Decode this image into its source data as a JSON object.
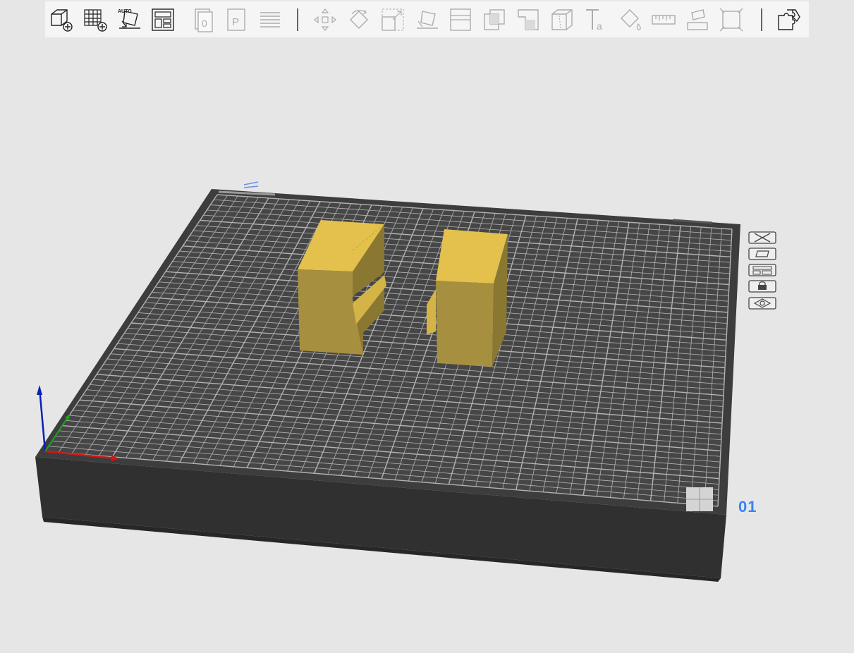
{
  "toolbar": {
    "buttons": [
      {
        "id": "add-object",
        "enabled": true
      },
      {
        "id": "add-plate",
        "enabled": true
      },
      {
        "id": "auto-orient",
        "label": "AUTO",
        "enabled": true
      },
      {
        "id": "arrange",
        "enabled": true
      },
      {
        "id": "copy",
        "enabled": false
      },
      {
        "id": "paste",
        "enabled": false
      },
      {
        "id": "layers",
        "enabled": false
      },
      {
        "id": "move",
        "enabled": false
      },
      {
        "id": "rotate",
        "enabled": false
      },
      {
        "id": "scale",
        "enabled": false
      },
      {
        "id": "lay-on-face",
        "enabled": false
      },
      {
        "id": "cut",
        "enabled": false
      },
      {
        "id": "boolean",
        "enabled": false
      },
      {
        "id": "support-paint",
        "enabled": false
      },
      {
        "id": "seam-paint",
        "enabled": false
      },
      {
        "id": "text",
        "label": "Ta",
        "enabled": false
      },
      {
        "id": "color-paint",
        "enabled": false
      },
      {
        "id": "measure",
        "enabled": false
      },
      {
        "id": "assembly",
        "enabled": false
      },
      {
        "id": "fullscreen",
        "enabled": false
      },
      {
        "id": "split-parts",
        "enabled": true
      }
    ]
  },
  "plate": {
    "label": "01",
    "side_controls": [
      "delete",
      "orient",
      "arrange",
      "lock",
      "settings"
    ]
  },
  "colors": {
    "model": "#e3c14c",
    "plate": "#3c3d3c",
    "grid": "#cfcfcf",
    "accent": "#3b82f6"
  }
}
